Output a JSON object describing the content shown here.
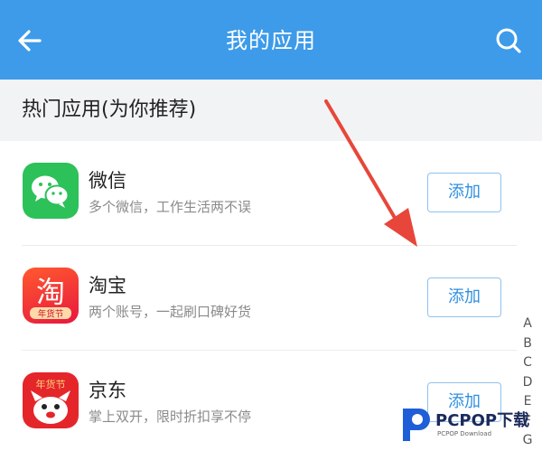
{
  "header": {
    "title": "我的应用"
  },
  "section": {
    "title": "热门应用(为你推荐)"
  },
  "apps": [
    {
      "name": "微信",
      "desc": "多个微信，工作生活两不误",
      "button": "添加",
      "icon": "wechat-icon",
      "icon_color": "#2dc15a"
    },
    {
      "name": "淘宝",
      "desc": "两个账号，一起刷口碑好货",
      "button": "添加",
      "icon": "taobao-icon",
      "icon_color": "#f43a3a",
      "icon_text": "淘",
      "icon_badge": "年货节"
    },
    {
      "name": "京东",
      "desc": "掌上双开，限时折扣享不停",
      "button": "添加",
      "icon": "jd-icon",
      "icon_color": "#e4262b",
      "icon_text": "年货节"
    }
  ],
  "index_letters": [
    "A",
    "B",
    "C",
    "D",
    "E",
    "F",
    "G"
  ],
  "watermark": {
    "brand": "PCPOP下载",
    "sub": "PCPOP Download"
  },
  "colors": {
    "header_bg": "#3d9be9",
    "section_bg": "#f2f3f5",
    "button_border": "#8fc3ef",
    "button_text": "#2f8fe0",
    "arrow": "#e8463a"
  }
}
